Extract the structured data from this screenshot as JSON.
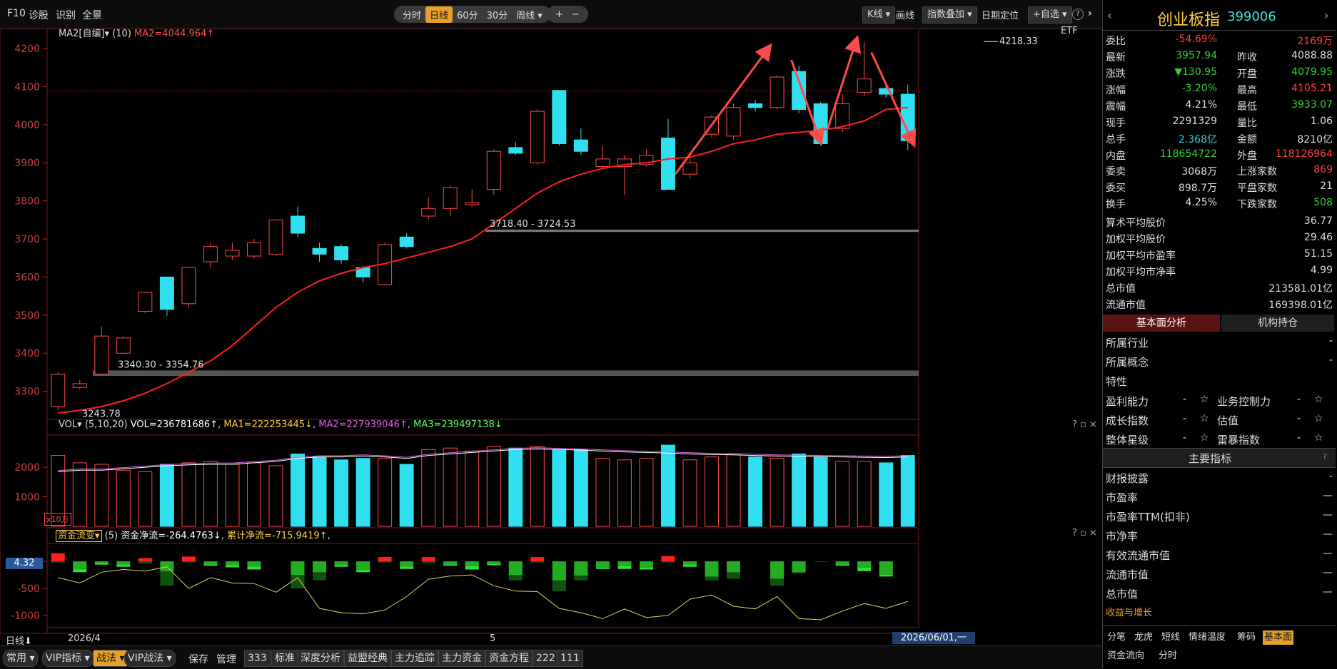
{
  "topbar": {
    "f10": "F10",
    "diag": "诊股",
    "identify": "识别",
    "overview": "全景",
    "periods": [
      "分时",
      "日线",
      "60分",
      "30分",
      "周线 ▾"
    ],
    "active_period": "日线",
    "zoom_in": "+",
    "zoom_out": "−",
    "kline": "K线 ▾",
    "draw": "画线",
    "overlay": "指数叠加 ▾",
    "datepos": "日期定位",
    "watch": "+自选 ▾",
    "help": "?",
    "collapse": "›"
  },
  "main_chart": {
    "ma_legend_name": "MA2[自编]▾",
    "ma_legend_param": "(10)",
    "ma_legend_val": "MA2=4044.964↑",
    "etf": "ETF",
    "y_ticks": [
      "4200",
      "4100",
      "4000",
      "3900",
      "3800",
      "3700",
      "3600",
      "3500",
      "3400",
      "3300"
    ],
    "ann_high": "4218.33",
    "ann_low": "3243.78",
    "ann_range1": "3340.30 - 3354.76",
    "ann_range2": "3718.40 - 3724.53"
  },
  "vol_panel": {
    "name": "VOL▾",
    "params": "(5,10,20)",
    "vol": "VOL=236781686↑",
    "ma1": "MA1=222253445↓",
    "ma2": "MA2=227939046↑",
    "ma3": "MA3=239497138↓",
    "y_ticks": [
      "2000",
      "1000"
    ],
    "unit": "x10万",
    "controls": "? ▫ ×"
  },
  "flow_panel": {
    "name": "资金流变▾",
    "param": "(5)",
    "net": "资金净流=-264.4763↓",
    "cum": "累计净流=-715.9419↑",
    "y_ticks": [
      "0",
      "-500",
      "-1000"
    ],
    "cursor_val": "4.32",
    "controls": "? ▫ ×"
  },
  "xaxis": {
    "label": "日线⬇",
    "d1": "2026/4",
    "d2": "5",
    "cursor": "2026/06/01,一"
  },
  "bottombar": {
    "tabs": [
      "常用 ▾",
      "VIP指标 ▾",
      "战法 ▾",
      "VIP战法 ▾"
    ],
    "active_tab": "战法 ▾",
    "items": [
      "保存",
      "管理",
      "333",
      "标准",
      "深度分析",
      "益盟经典",
      "主力追踪",
      "主力资金",
      "资金方程",
      "222",
      "111"
    ]
  },
  "right_panel": {
    "title": "创业板指",
    "code": "399006",
    "quote": [
      {
        "l": "委比",
        "v": "-54.69%",
        "r": "",
        "rv": "2169万",
        "vc": "#ff4040",
        "rvc": "#ff4040"
      },
      {
        "l": "最新",
        "v": "3957.94",
        "r": "昨收",
        "rv": "4088.88",
        "vc": "#35d035",
        "rvc": "#ddd"
      },
      {
        "l": "涨跌",
        "v": "▼130.95",
        "r": "开盘",
        "rv": "4079.95",
        "vc": "#35d035",
        "rvc": "#35d035"
      },
      {
        "l": "涨幅",
        "v": "-3.20%",
        "r": "最高",
        "rv": "4105.21",
        "vc": "#35d035",
        "rvc": "#ff4040"
      },
      {
        "l": "震幅",
        "v": "4.21%",
        "r": "最低",
        "rv": "3933.07",
        "vc": "#ddd",
        "rvc": "#35d035"
      },
      {
        "l": "现手",
        "v": "2291329",
        "r": "量比",
        "rv": "1.06",
        "vc": "#ddd",
        "rvc": "#ddd"
      },
      {
        "l": "总手",
        "v": "2.368亿",
        "r": "金额",
        "rv": "8210亿",
        "vc": "#35d0d0",
        "rvc": "#ddd"
      },
      {
        "l": "内盘",
        "v": "118654722",
        "r": "外盘",
        "rv": "118126964",
        "vc": "#35d035",
        "rvc": "#ff4040"
      }
    ],
    "breadth": [
      {
        "l": "委卖",
        "v": "3068万",
        "r": "上涨家数",
        "rv": "869",
        "vc": "#ddd",
        "rvc": "#ff4040"
      },
      {
        "l": "委买",
        "v": "898.7万",
        "r": "平盘家数",
        "rv": "21",
        "vc": "#ddd",
        "rvc": "#ddd"
      },
      {
        "l": "换手",
        "v": "4.25%",
        "r": "下跌家数",
        "rv": "508",
        "vc": "#ddd",
        "rvc": "#35d035"
      }
    ],
    "stats": [
      {
        "l": "算术平均股价",
        "v": "36.77"
      },
      {
        "l": "加权平均股价",
        "v": "29.46"
      },
      {
        "l": "加权平均市盈率",
        "v": "51.15"
      },
      {
        "l": "加权平均市净率",
        "v": "4.99"
      },
      {
        "l": "总市值",
        "v": "213581.01亿"
      },
      {
        "l": "流通市值",
        "v": "169398.01亿"
      }
    ],
    "tabs": [
      "基本面分析",
      "机构持仓"
    ],
    "fund": [
      {
        "l": "所属行业",
        "v": "-"
      },
      {
        "l": "所属概念",
        "v": "-"
      }
    ],
    "trait": "特性",
    "ratings": [
      {
        "l": "盈利能力",
        "v": "-",
        "r": "业务控制力",
        "rv": "-"
      },
      {
        "l": "成长指数",
        "v": "-",
        "r": "估值",
        "rv": "-"
      },
      {
        "l": "整体星级",
        "v": "-",
        "r": "雷暴指数",
        "rv": "-"
      }
    ],
    "key_header": "主要指标",
    "key": [
      {
        "l": "财报披露",
        "v": "-"
      },
      {
        "l": "市盈率",
        "v": "—"
      },
      {
        "l": "市盈率TTM(扣非)",
        "v": "—"
      },
      {
        "l": "市净率",
        "v": "—"
      },
      {
        "l": "有效流通市值",
        "v": "—"
      },
      {
        "l": "流通市值",
        "v": "—"
      },
      {
        "l": "总市值",
        "v": "—"
      }
    ],
    "growth": "收益与增长",
    "btabs": [
      "分笔",
      "龙虎",
      "短线",
      "情绪温度",
      "筹码",
      "基本面"
    ],
    "btabs_active": "基本面",
    "btabs2": [
      "资金流向",
      "分时"
    ]
  },
  "chart_data": {
    "type": "candlestick",
    "ylim": [
      3230,
      4230
    ],
    "candles": [
      [
        3260,
        3345,
        3250,
        3350
      ],
      [
        3310,
        3320,
        3305,
        3330
      ],
      [
        3345,
        3445,
        3340,
        3470
      ],
      [
        3400,
        3440,
        3398,
        3445
      ],
      [
        3510,
        3560,
        3505,
        3560
      ],
      [
        3600,
        3515,
        3498,
        3600
      ],
      [
        3530,
        3625,
        3520,
        3625
      ],
      [
        3640,
        3680,
        3625,
        3690
      ],
      [
        3655,
        3670,
        3645,
        3690
      ],
      [
        3655,
        3690,
        3650,
        3700
      ],
      [
        3660,
        3750,
        3655,
        3752
      ],
      [
        3760,
        3715,
        3705,
        3785
      ],
      [
        3675,
        3660,
        3640,
        3690
      ],
      [
        3680,
        3645,
        3635,
        3685
      ],
      [
        3625,
        3600,
        3585,
        3630
      ],
      [
        3580,
        3685,
        3578,
        3690
      ],
      [
        3705,
        3680,
        3675,
        3715
      ],
      [
        3760,
        3780,
        3750,
        3810
      ],
      [
        3780,
        3835,
        3760,
        3840
      ],
      [
        3790,
        3795,
        3785,
        3830
      ],
      [
        3830,
        3930,
        3815,
        3935
      ],
      [
        3940,
        3925,
        3920,
        3955
      ],
      [
        3900,
        4035,
        3895,
        4040
      ],
      [
        4090,
        3950,
        3945,
        4090
      ],
      [
        3960,
        3930,
        3920,
        3990
      ],
      [
        3890,
        3910,
        3885,
        3945
      ],
      [
        3890,
        3910,
        3815,
        3920
      ],
      [
        3895,
        3920,
        3890,
        3935
      ],
      [
        3965,
        3830,
        3830,
        4015
      ],
      [
        3870,
        3900,
        3860,
        3920
      ],
      [
        3975,
        4020,
        3965,
        4025
      ],
      [
        3970,
        4045,
        3960,
        4055
      ],
      [
        4055,
        4045,
        4035,
        4065
      ],
      [
        4045,
        4125,
        4040,
        4130
      ],
      [
        4140,
        4040,
        4030,
        4155
      ],
      [
        4055,
        3950,
        3945,
        4060
      ],
      [
        3990,
        4055,
        3980,
        4080
      ],
      [
        4085,
        4120,
        4075,
        4218
      ],
      [
        4095,
        4080,
        4070,
        4110
      ],
      [
        4080,
        3958,
        3933,
        4105
      ]
    ],
    "ma": [
      3243,
      3250,
      3260,
      3275,
      3295,
      3320,
      3350,
      3380,
      3420,
      3470,
      3520,
      3560,
      3590,
      3610,
      3625,
      3635,
      3650,
      3665,
      3680,
      3700,
      3740,
      3780,
      3820,
      3850,
      3870,
      3885,
      3895,
      3900,
      3910,
      3915,
      3930,
      3950,
      3960,
      3975,
      3980,
      3985,
      3995,
      4010,
      4040,
      4045
    ],
    "volume": [
      2400,
      2150,
      2100,
      1900,
      1850,
      2100,
      2150,
      2200,
      2100,
      2150,
      2050,
      2450,
      2350,
      2250,
      2300,
      2300,
      2100,
      2600,
      2650,
      2550,
      2700,
      2650,
      2700,
      2600,
      2600,
      2300,
      2250,
      2300,
      2750,
      2250,
      2350,
      2450,
      2350,
      2300,
      2450,
      2350,
      2200,
      2200,
      2150,
      2400
    ],
    "vol_ma": [
      1850,
      1900,
      1900,
      1950,
      2000,
      2050,
      2080,
      2100,
      2100,
      2150,
      2200,
      2300,
      2350,
      2350,
      2380,
      2350,
      2300,
      2400,
      2450,
      2500,
      2550,
      2600,
      2620,
      2600,
      2580,
      2550,
      2520,
      2500,
      2480,
      2450,
      2430,
      2420,
      2400,
      2380,
      2370,
      2360,
      2350,
      2340,
      2330,
      2350
    ],
    "vol_ylim": [
      0,
      2800
    ],
    "flow_bars": [
      [
        150,
        -20
      ],
      [
        -200,
        -150
      ],
      [
        -60,
        -30
      ],
      [
        -100,
        -60
      ],
      [
        60,
        -40
      ],
      [
        -180,
        -450
      ],
      [
        90,
        -20
      ],
      [
        -80,
        -60
      ],
      [
        -110,
        -70
      ],
      [
        -150,
        -100
      ],
      [
        0,
        0
      ],
      [
        -250,
        -500
      ],
      [
        -200,
        -350
      ],
      [
        -100,
        -70
      ],
      [
        -200,
        -160
      ],
      [
        80,
        -20
      ],
      [
        -140,
        -100
      ],
      [
        80,
        -30
      ],
      [
        -80,
        -60
      ],
      [
        -150,
        -90
      ],
      [
        -70,
        -50
      ],
      [
        -250,
        -350
      ],
      [
        80,
        -20
      ],
      [
        -350,
        -550
      ],
      [
        -260,
        -350
      ],
      [
        -140,
        -120
      ],
      [
        -140,
        -90
      ],
      [
        -150,
        -120
      ],
      [
        100,
        -20
      ],
      [
        -100,
        -60
      ],
      [
        -280,
        -350
      ],
      [
        -200,
        -320
      ],
      [
        0,
        0
      ],
      [
        -320,
        -450
      ],
      [
        -200,
        -220
      ],
      [
        0,
        -10
      ],
      [
        -80,
        -60
      ],
      [
        -180,
        -120
      ],
      [
        -280,
        -250
      ],
      [
        0,
        0
      ]
    ],
    "flow_line": [
      -300,
      -400,
      -200,
      -150,
      -180,
      -100,
      -500,
      -300,
      -400,
      -410,
      -570,
      -300,
      -870,
      -950,
      -970,
      -900,
      -650,
      -330,
      -270,
      -250,
      -450,
      -550,
      -560,
      -870,
      -950,
      -1060,
      -880,
      -1040,
      -1000,
      -700,
      -620,
      -830,
      -880,
      -650,
      -1060,
      -1080,
      -920,
      -780,
      -870,
      -740
    ],
    "flow_ylim": [
      -1200,
      200
    ]
  }
}
